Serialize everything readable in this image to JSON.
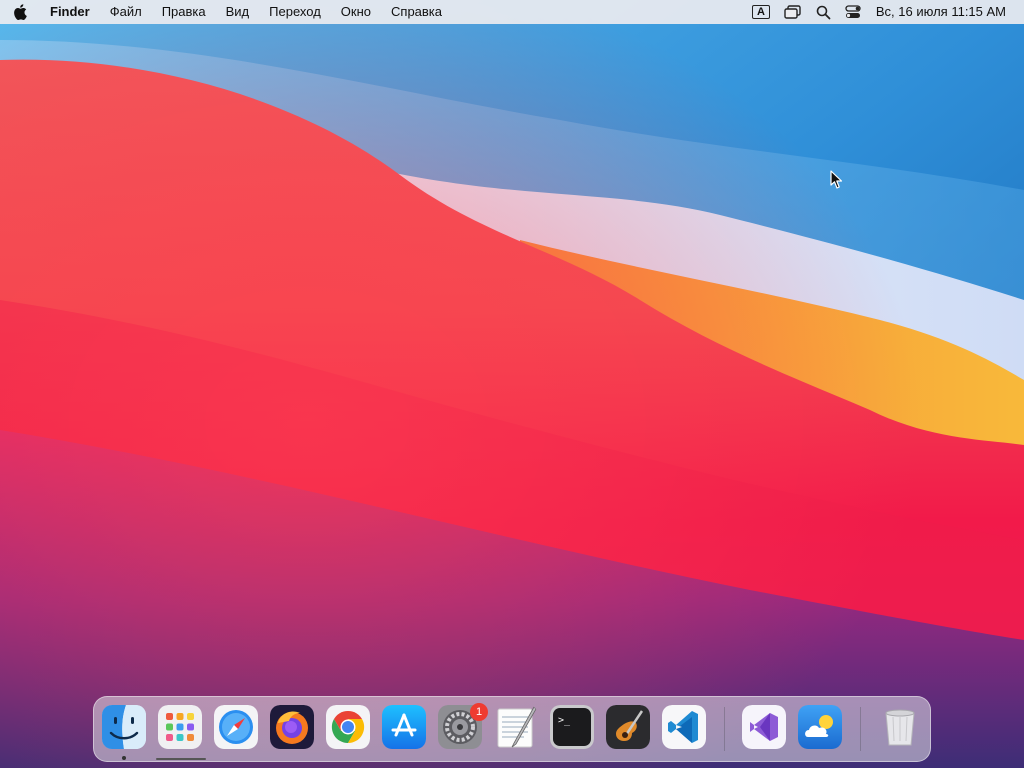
{
  "menubar": {
    "apple_icon": "apple-logo-icon",
    "app_name": "Finder",
    "menus": [
      "Файл",
      "Правка",
      "Вид",
      "Переход",
      "Окно",
      "Справка"
    ],
    "status": {
      "input_source": "A",
      "clock": "Вс, 16 июля  11:15 AM"
    }
  },
  "desktop": {
    "wallpaper": "macos-big-sur-wallpaper",
    "colors": {
      "sky_blue": "#3fa0e0",
      "deep_blue": "#1b5fb0",
      "red": "#f2254a",
      "orange": "#f7a233",
      "purple": "#6a2a8a"
    }
  },
  "dock": {
    "apps": [
      {
        "name": "Finder",
        "icon": "finder-icon",
        "running": true
      },
      {
        "name": "Launchpad",
        "icon": "launchpad-icon",
        "running": false
      },
      {
        "name": "Safari",
        "icon": "safari-icon",
        "running": false
      },
      {
        "name": "Firefox",
        "icon": "firefox-icon",
        "running": false
      },
      {
        "name": "Google Chrome",
        "icon": "chrome-icon",
        "running": false
      },
      {
        "name": "App Store",
        "icon": "app-store-icon",
        "running": false
      },
      {
        "name": "System Preferences",
        "icon": "system-preferences-icon",
        "running": false,
        "badge": "1"
      },
      {
        "name": "TextEdit",
        "icon": "textedit-icon",
        "running": false
      },
      {
        "name": "Terminal",
        "icon": "terminal-icon",
        "running": false
      },
      {
        "name": "GarageBand",
        "icon": "garageband-icon",
        "running": false
      },
      {
        "name": "Visual Studio Code",
        "icon": "vscode-icon",
        "running": false
      },
      {
        "name": "Visual Studio",
        "icon": "visual-studio-icon",
        "running": false
      },
      {
        "name": "Weather",
        "icon": "weather-icon",
        "running": false
      },
      {
        "name": "Trash",
        "icon": "trash-icon",
        "running": false
      }
    ],
    "terminal_prompt": ">_"
  }
}
